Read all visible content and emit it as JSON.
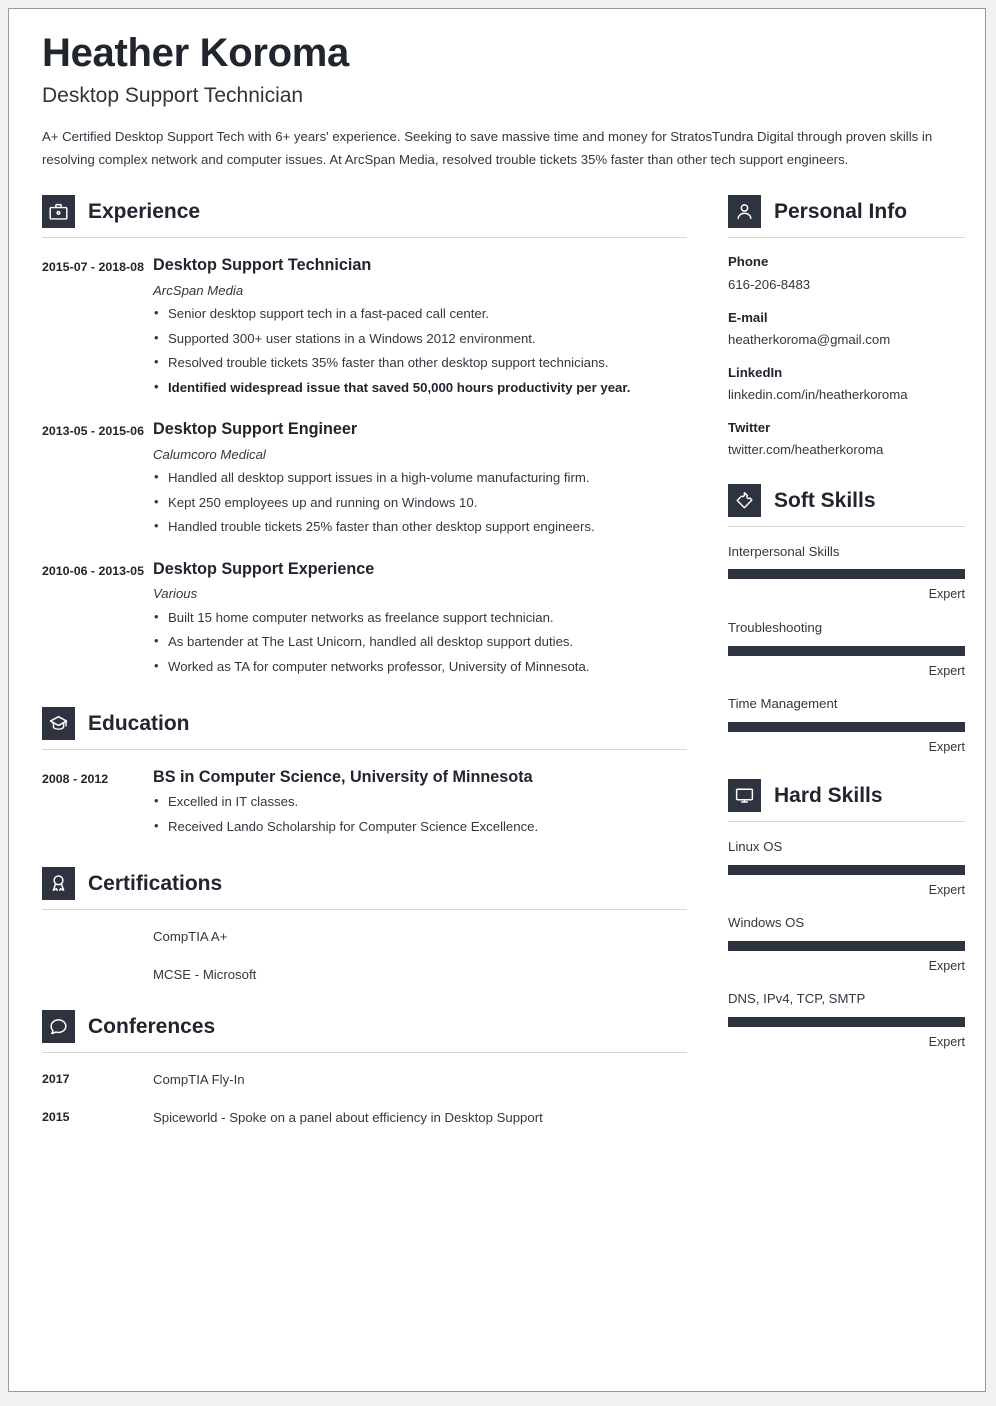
{
  "header": {
    "name": "Heather Koroma",
    "job_title": "Desktop Support Technician",
    "summary": "A+ Certified Desktop Support Tech with 6+ years' experience. Seeking to save massive time and money for StratosTundra Digital through proven skills in resolving complex network and computer issues. At ArcSpan Media, resolved trouble tickets 35% faster than other tech support engineers."
  },
  "theme": {
    "accent": "#2d333f",
    "text": "#33373f",
    "heading": "#21252e",
    "rule": "#d6d6d6",
    "page_bg": "#ffffff"
  },
  "sections": {
    "experience": {
      "title": "Experience",
      "icon": "briefcase-icon",
      "entries": [
        {
          "date": "2015-07 - 2018-08",
          "title": "Desktop Support Technician",
          "org": "ArcSpan Media",
          "bullets": [
            {
              "text": "Senior desktop support tech in a fast-paced call center.",
              "bold": false
            },
            {
              "text": "Supported 300+ user stations in a Windows 2012 environment.",
              "bold": false
            },
            {
              "text": "Resolved trouble tickets 35% faster than other desktop support technicians.",
              "bold": false
            },
            {
              "text": "Identified widespread issue that saved 50,000 hours productivity per year.",
              "bold": true
            }
          ]
        },
        {
          "date": "2013-05 - 2015-06",
          "title": "Desktop Support Engineer",
          "org": "Calumcoro Medical",
          "bullets": [
            {
              "text": "Handled all desktop support issues in a high-volume manufacturing firm.",
              "bold": false
            },
            {
              "text": "Kept 250 employees up and running on Windows 10.",
              "bold": false
            },
            {
              "text": "Handled trouble tickets 25% faster than other desktop support engineers.",
              "bold": false
            }
          ]
        },
        {
          "date": "2010-06 - 2013-05",
          "title": "Desktop Support Experience",
          "org": "Various",
          "bullets": [
            {
              "text": "Built 15 home computer networks as freelance support technician.",
              "bold": false
            },
            {
              "text": "As bartender at The Last Unicorn, handled all desktop support duties.",
              "bold": false
            },
            {
              "text": "Worked as TA for computer networks professor, University of Minnesota.",
              "bold": false
            }
          ]
        }
      ]
    },
    "education": {
      "title": "Education",
      "icon": "graduation-cap-icon",
      "entries": [
        {
          "date": "2008 - 2012",
          "title": "BS in Computer Science, University of Minnesota",
          "bullets": [
            {
              "text": "Excelled in IT classes.",
              "bold": false
            },
            {
              "text": "Received Lando Scholarship for Computer Science Excellence.",
              "bold": false
            }
          ]
        }
      ]
    },
    "certifications": {
      "title": "Certifications",
      "icon": "award-ribbon-icon",
      "rows": [
        {
          "label": "",
          "text": "CompTIA A+"
        },
        {
          "label": "",
          "text": "MCSE - Microsoft"
        }
      ]
    },
    "conferences": {
      "title": "Conferences",
      "icon": "speech-bubble-icon",
      "rows": [
        {
          "label": "2017",
          "text": "CompTIA Fly-In"
        },
        {
          "label": "2015",
          "text": "Spiceworld - Spoke on a panel about efficiency in Desktop Support"
        }
      ]
    },
    "personal_info": {
      "title": "Personal Info",
      "icon": "person-icon",
      "fields": [
        {
          "label": "Phone",
          "value": "616-206-8483"
        },
        {
          "label": "E-mail",
          "value": "heatherkoroma@gmail.com"
        },
        {
          "label": "LinkedIn",
          "value": "linkedin.com/in/heatherkoroma"
        },
        {
          "label": "Twitter",
          "value": "twitter.com/heatherkoroma"
        }
      ]
    },
    "soft_skills": {
      "title": "Soft Skills",
      "icon": "puzzle-piece-icon",
      "skills": [
        {
          "name": "Interpersonal Skills",
          "level": "Expert",
          "percent": 100
        },
        {
          "name": "Troubleshooting",
          "level": "Expert",
          "percent": 100
        },
        {
          "name": "Time Management",
          "level": "Expert",
          "percent": 100
        }
      ]
    },
    "hard_skills": {
      "title": "Hard Skills",
      "icon": "monitor-icon",
      "skills": [
        {
          "name": "Linux OS",
          "level": "Expert",
          "percent": 100
        },
        {
          "name": "Windows OS",
          "level": "Expert",
          "percent": 100
        },
        {
          "name": "DNS, IPv4, TCP, SMTP",
          "level": "Expert",
          "percent": 100
        }
      ]
    }
  }
}
